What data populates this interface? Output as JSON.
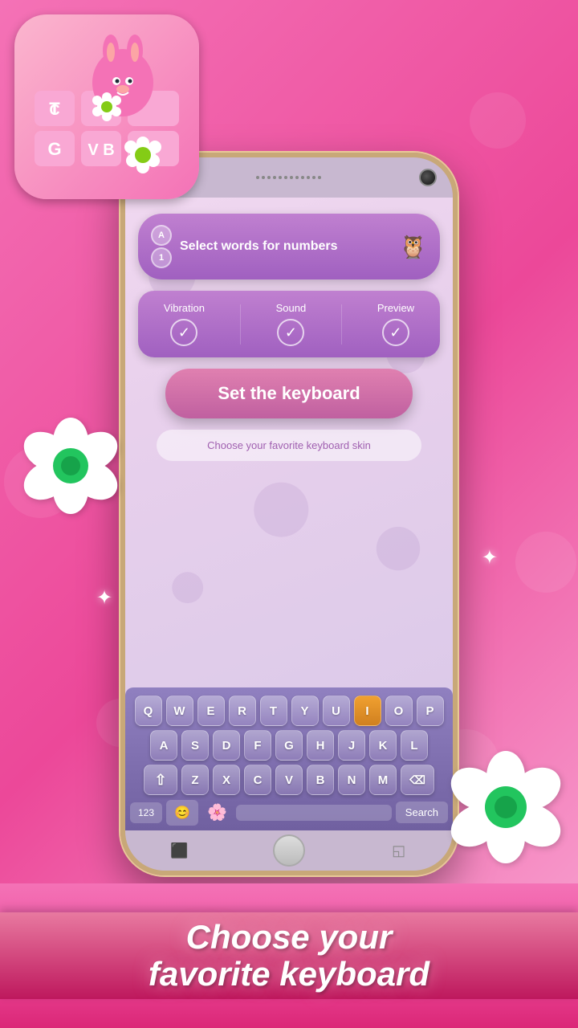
{
  "background": {
    "color": "#ec4899"
  },
  "appIcon": {
    "visible": true
  },
  "screen": {
    "selectWordsBtn": {
      "label": "Select words for numbers",
      "iconA": "A",
      "icon1": "1"
    },
    "optionsPanel": {
      "vibration": "Vibration",
      "sound": "Sound",
      "preview": "Preview"
    },
    "setKeyboardBtn": {
      "label": "Set the keyboard"
    },
    "chooseSkinBtn": {
      "label": "Choose your favorite keyboard skin"
    },
    "keyboard": {
      "row1": [
        "Q",
        "W",
        "E",
        "R",
        "T",
        "Y",
        "U",
        "I",
        "O",
        "P"
      ],
      "row2": [
        "A",
        "S",
        "D",
        "F",
        "G",
        "H",
        "J",
        "K",
        "L"
      ],
      "row3": [
        "Z",
        "X",
        "C",
        "V",
        "B",
        "N",
        "M"
      ],
      "searchLabel": "Search",
      "numpadLabel": "123"
    }
  },
  "banner": {
    "line1": "Choose your",
    "line2": "favorite keyboard"
  }
}
